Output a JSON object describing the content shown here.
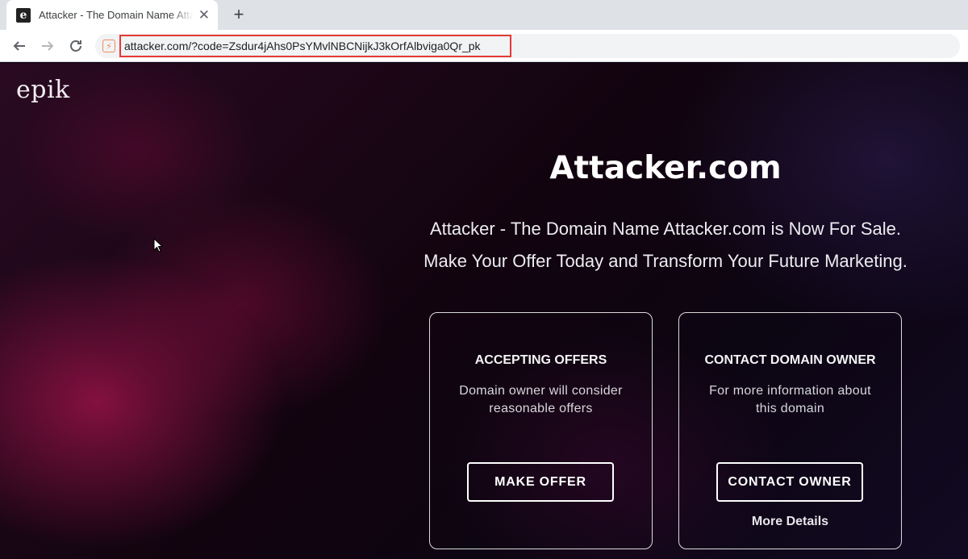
{
  "browser": {
    "tab": {
      "title": "Attacker - The Domain Name Attacker.com",
      "favicon_letter": "e",
      "close_glyph": "✕"
    },
    "new_tab_glyph": "+",
    "address_bar": {
      "url": "attacker.com/?code=Zsdur4jAhs0PsYMvlNBCNijkJ3kOrfAlbviga0Qr_pk",
      "site_icon": "⚡",
      "highlight_color": "#e53935"
    }
  },
  "page": {
    "logo": "epik",
    "headline": "Attacker.com",
    "tagline_line1": "Attacker - The Domain Name Attacker.com is Now For Sale.",
    "tagline_line2": "Make Your Offer Today and Transform Your Future Marketing.",
    "cards": [
      {
        "title": "ACCEPTING OFFERS",
        "description": "Domain owner will consider reasonable offers",
        "button": "MAKE OFFER"
      },
      {
        "title": "CONTACT DOMAIN OWNER",
        "description": "For more information about this domain",
        "button": "CONTACT OWNER",
        "link": "More Details"
      }
    ]
  },
  "colors": {
    "page_bg": "#12040f",
    "accent_magenta": "#96124a",
    "text": "#ffffff"
  }
}
